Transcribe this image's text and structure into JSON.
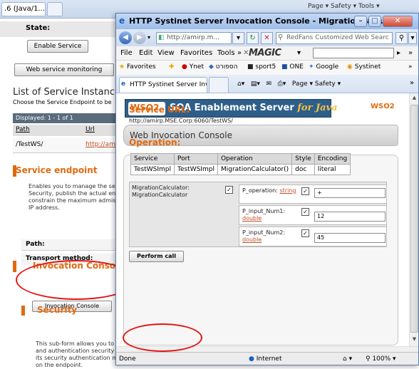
{
  "background_window": {
    "tab_label": ".6 (Java/1....",
    "toolbar_right": "Page ▾  Safety ▾  Tools ▾",
    "state_label": "State:",
    "enable_service_button": "Enable Service",
    "ws_monitoring_button": "Web service monitoring",
    "list_title": "List of Service Instance",
    "list_subtitle": "Choose the Service Endpoint to be",
    "displayed": "Displayed: 1 - 1 of 1",
    "table": {
      "headers": [
        "Path",
        "Url"
      ],
      "rows": [
        [
          "/TestWS/",
          "http://ami"
        ]
      ]
    },
    "service_endpoint": {
      "title": "Service endpoint",
      "text": "Enables you to manage the se Security, publish the actual en constrain the maximum admiss IP address.",
      "path_label": "Path:",
      "transport_label": "Transport method:"
    },
    "invocation_console": {
      "title": "Invocation Console",
      "button": "Invocation Console"
    },
    "security": {
      "title": "Security",
      "text": "This sub-form allows you to and authentication security its security authentication m on the endpoint."
    }
  },
  "ie_window": {
    "title": "HTTP Systinet Server Invocation Console - MigrationCalculator",
    "address": "http://amirp.m...",
    "search_placeholder": "RedFans Customized Web Searc",
    "menu": [
      "File",
      "Edit",
      "View",
      "Favorites",
      "Tools",
      "»"
    ],
    "magic_logo": "MAGIC",
    "favorites": [
      "Favorites",
      "Ynet",
      "הספורט",
      "sport5",
      "ONE",
      "Google",
      "Systinet"
    ],
    "tab_label": "HTTP Systinet Server Invo...",
    "command_bar": "Page ▾   Safety ▾"
  },
  "page": {
    "banner_logo": "WSO2",
    "banner_title": "SOA Enablement Server",
    "banner_title_italic": "for Java",
    "corner_logo": "WSO2",
    "console_title": "Web Invocation Console",
    "service_url_label": "Service URL:",
    "service_url": "http://amirp.MSE.Corp:6060/TestWS/",
    "operation_label": "Operation:",
    "operation_table": {
      "headers": [
        "Service",
        "Port",
        "Operation",
        "Style",
        "Encoding"
      ],
      "row": [
        "TestWSImpl",
        "TestWSImpl",
        "MigrationCalculator()",
        "doc",
        "literal"
      ]
    },
    "method_name": "MigrationCalculator: MigrationCalculator",
    "params": [
      {
        "name": "P_operation:",
        "type": "string",
        "value": "+"
      },
      {
        "name": "P_input_Num1:",
        "type": "double",
        "value": "12"
      },
      {
        "name": "P_input_Num2:",
        "type": "double",
        "value": "45"
      }
    ],
    "perform_button": "Perform call"
  },
  "statusbar": {
    "status": "Done",
    "zone": "Internet",
    "zoom": "100%"
  },
  "colors": {
    "accent_orange": "#e06a10",
    "banner_blue": "#2e5f8a",
    "annotation_red": "#e41414"
  }
}
